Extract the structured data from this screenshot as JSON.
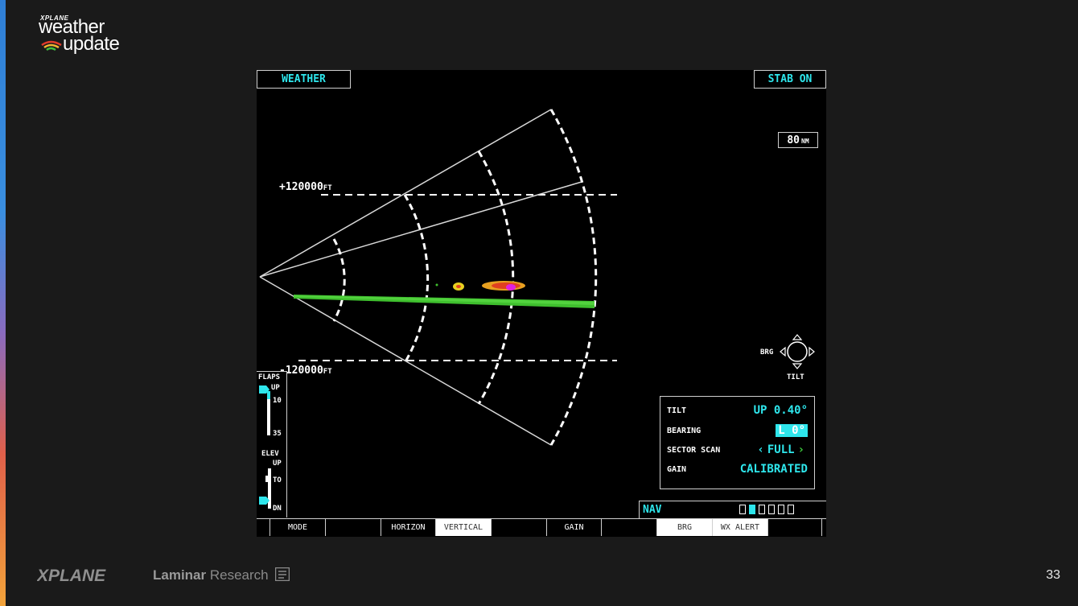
{
  "slide": {
    "logo_small": "XPLANE",
    "logo_line1": "weather",
    "logo_line2": "update",
    "page_number": "33",
    "footer_brand": "XPLANE",
    "footer_company_bold": "Laminar",
    "footer_company_light": " Research"
  },
  "display": {
    "mode_title": "WEATHER",
    "stab_status": "STAB ON",
    "range_value": "80",
    "range_unit": "NM",
    "upper_alt_value": "+120000",
    "upper_alt_unit": "FT",
    "lower_alt_value": "-120000",
    "lower_alt_unit": "FT"
  },
  "flaps": {
    "title": "FLAPS",
    "up": "UP",
    "ten": "10",
    "thirtyfive": "35",
    "elev_title": "ELEV",
    "elev_up": "UP",
    "elev_to": "TO",
    "elev_dn": "DN"
  },
  "brg_tilt": {
    "brg": "BRG",
    "tilt": "TILT"
  },
  "settings": {
    "tilt_label": "TILT",
    "tilt_value": "UP 0.40°",
    "bearing_label": "BEARING",
    "bearing_value": "L 0°",
    "sector_label": "SECTOR SCAN",
    "sector_value": "FULL",
    "gain_label": "GAIN",
    "gain_value": "CALIBRATED"
  },
  "nav": {
    "label": "NAV",
    "pages_total": 6,
    "page_active": 2
  },
  "softkeys": [
    "",
    "MODE",
    "",
    "HORIZON",
    "VERTICAL",
    "",
    "GAIN",
    "",
    "BRG",
    "WX ALERT",
    ""
  ],
  "softkeys_active": [
    "VERTICAL",
    "BRG",
    "WX ALERT"
  ],
  "colors": {
    "accent_cyan": "#2ee6ec",
    "radar_green": "#3fbf2e",
    "weather_magenta": "#e020e0",
    "weather_yellow": "#e8d020"
  }
}
